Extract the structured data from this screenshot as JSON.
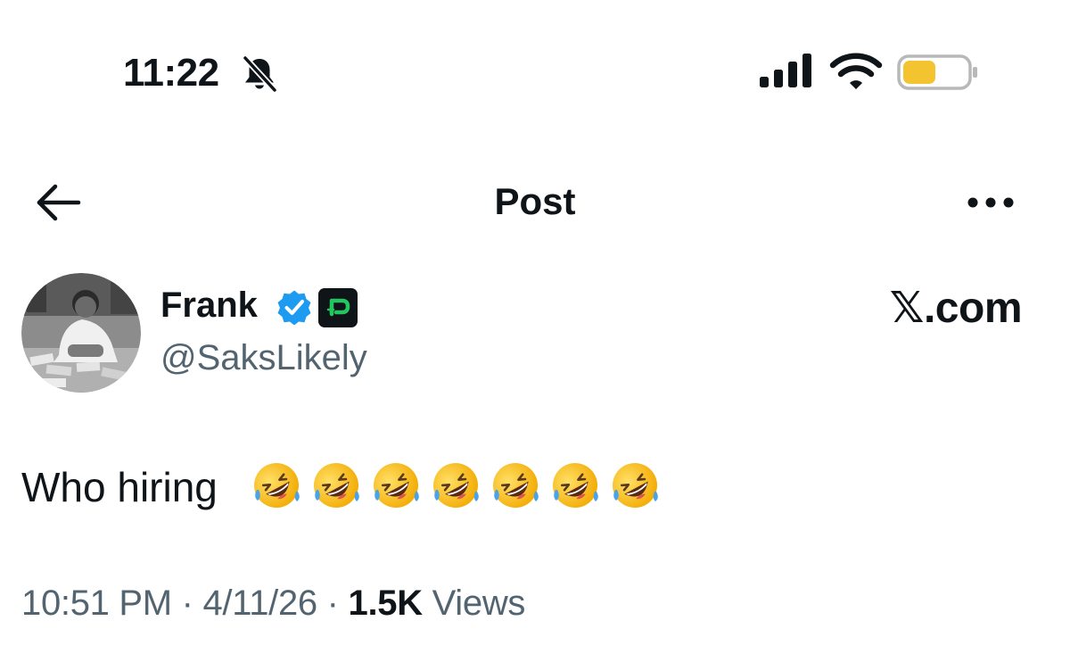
{
  "status_bar": {
    "time": "11:22",
    "icons": [
      "bell-slash-icon",
      "cellular-signal-icon",
      "wifi-icon",
      "battery-icon"
    ],
    "battery_level": 0.35
  },
  "header": {
    "title": "Post",
    "back_icon": "arrow-left-icon",
    "more_icon": "more-horizontal-icon"
  },
  "author": {
    "name": "Frank",
    "handle": "@SaksLikely",
    "verified_icon": "verified-badge-icon",
    "badge_icon": "app-badge-icon"
  },
  "watermark": "𝕏.com",
  "post": {
    "text": "Who hiring",
    "emojis": [
      "🤣",
      "🤣",
      "🤣",
      "🤣",
      "🤣",
      "🤣",
      "🤣"
    ]
  },
  "meta": {
    "time": "10:51 PM",
    "separator": " · ",
    "date": "4/11/26",
    "views_count": "1.5K",
    "views_label": "Views"
  },
  "colors": {
    "text": "#0f1419",
    "secondary": "#536471",
    "verified": "#1d9bf0",
    "battery": "#f4c430",
    "badge_bg": "#0f1419",
    "badge_accent": "#22c55e"
  }
}
